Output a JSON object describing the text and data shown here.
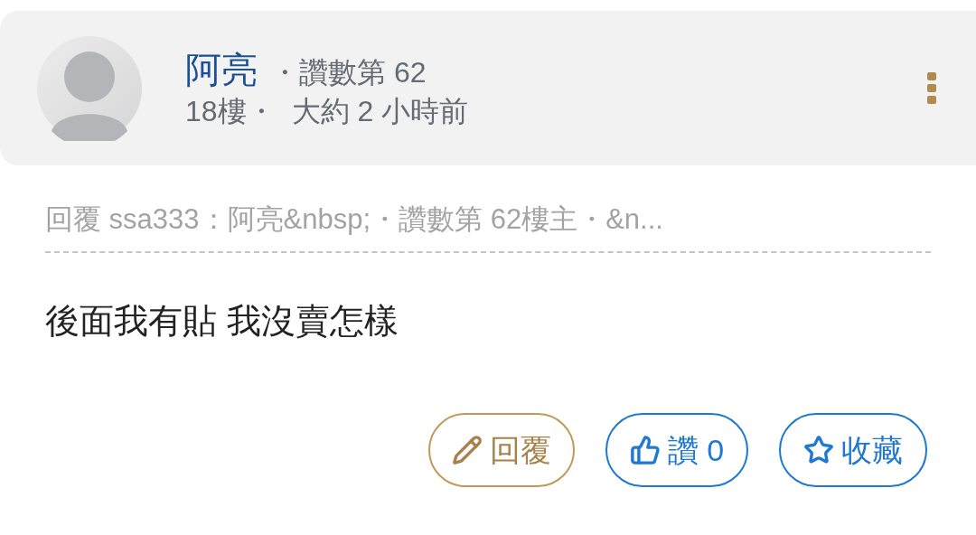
{
  "post": {
    "author": "阿亮",
    "rank": "・讚數第 62",
    "floor": "18樓・",
    "time": "大約 2 小時前"
  },
  "quote": "回覆 ssa333：阿亮&nbsp;・讚數第 62樓主・&n...",
  "body": "後面我有貼 我沒賣怎樣",
  "actions": [
    {
      "kind": "reply",
      "label": "回覆"
    },
    {
      "kind": "like",
      "label": "讚 0"
    },
    {
      "kind": "favorite",
      "label": "收藏"
    }
  ]
}
